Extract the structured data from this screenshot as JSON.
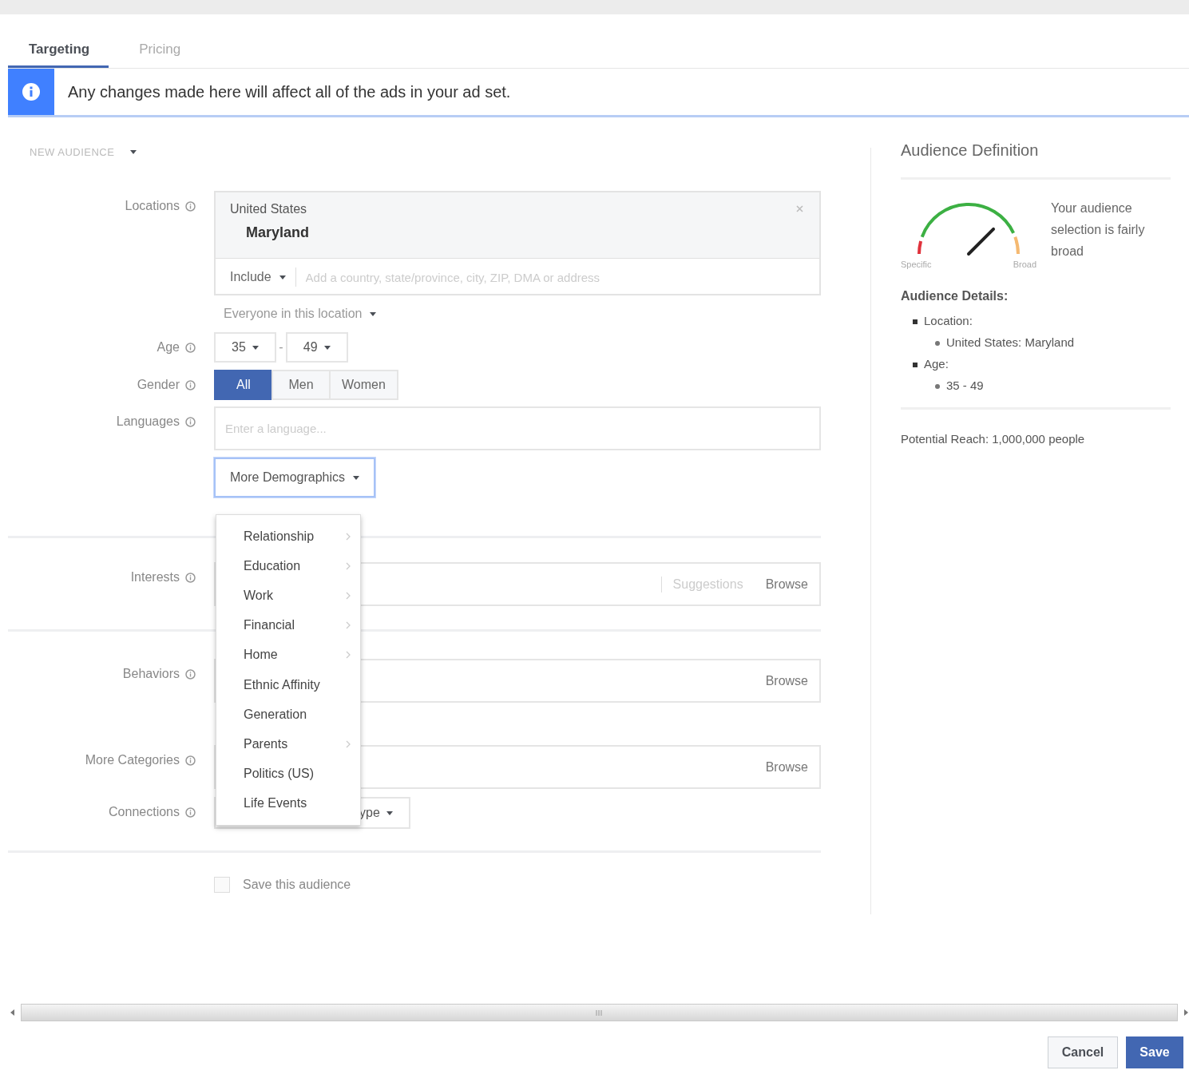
{
  "tabs": [
    {
      "label": "Targeting",
      "selected": true
    },
    {
      "label": "Pricing",
      "selected": false
    }
  ],
  "banner": {
    "text": "Any changes made here will affect all of the ads in your ad set."
  },
  "audience_menu": {
    "label": "NEW AUDIENCE"
  },
  "form": {
    "locations": {
      "label": "Locations",
      "country": "United States",
      "region": "Maryland",
      "mode": "Include",
      "placeholder": "Add a country, state/province, city, ZIP, DMA or address",
      "scope": "Everyone in this location"
    },
    "age": {
      "label": "Age",
      "min": "35",
      "separator": "-",
      "max": "49"
    },
    "gender": {
      "label": "Gender",
      "options": [
        {
          "label": "All",
          "selected": true
        },
        {
          "label": "Men",
          "selected": false
        },
        {
          "label": "Women",
          "selected": false
        }
      ]
    },
    "languages": {
      "label": "Languages",
      "placeholder": "Enter a language..."
    },
    "more_demographics": {
      "label": "More Demographics",
      "expanded": true,
      "menu": [
        {
          "label": "Relationship",
          "submenu": true
        },
        {
          "label": "Education",
          "submenu": true
        },
        {
          "label": "Work",
          "submenu": true
        },
        {
          "label": "Financial",
          "submenu": true
        },
        {
          "label": "Home",
          "submenu": true
        },
        {
          "label": "Ethnic Affinity",
          "submenu": false
        },
        {
          "label": "Generation",
          "submenu": false
        },
        {
          "label": "Parents",
          "submenu": true
        },
        {
          "label": "Politics (US)",
          "submenu": false
        },
        {
          "label": "Life Events",
          "submenu": false
        }
      ]
    },
    "interests": {
      "label": "Interests",
      "suggestions": "Suggestions",
      "browse": "Browse"
    },
    "behaviors": {
      "label": "Behaviors",
      "browse": "Browse"
    },
    "more_categories": {
      "label": "More Categories",
      "browse": "Browse"
    },
    "connections": {
      "label": "Connections",
      "value": "ype"
    },
    "save_audience": {
      "label": "Save this audience",
      "checked": false
    }
  },
  "side": {
    "title": "Audience Definition",
    "gauge": {
      "level": 0.75,
      "low_label": "Specific",
      "high_label": "Broad"
    },
    "summary": "Your audience selection is fairly broad",
    "details_title": "Audience Details:",
    "details": [
      {
        "label": "Location:",
        "children": [
          {
            "label": "United States: Maryland"
          }
        ]
      },
      {
        "label": "Age:",
        "children": [
          {
            "label": "35 - 49"
          }
        ]
      }
    ],
    "reach": "Potential Reach: 1,000,000 people"
  },
  "footer": {
    "buttons": [
      {
        "label": "Cancel",
        "kind": "secondary"
      },
      {
        "label": "Save",
        "kind": "primary"
      }
    ]
  }
}
